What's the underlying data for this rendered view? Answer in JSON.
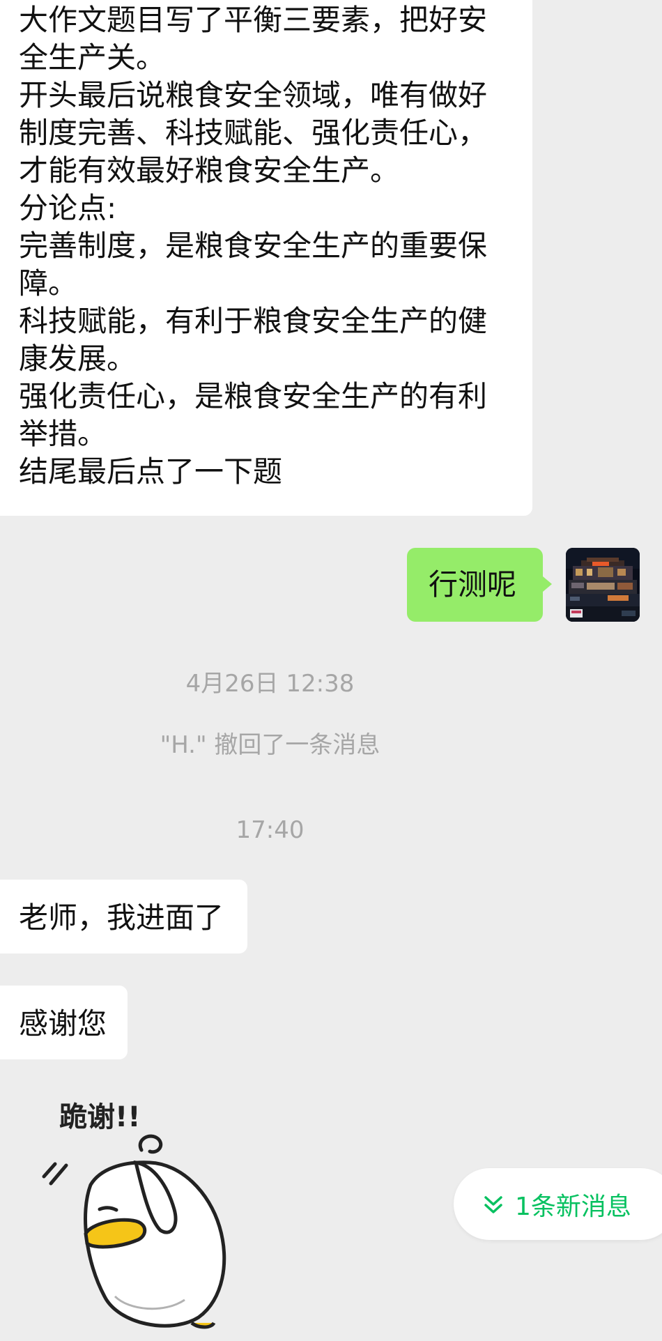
{
  "messages": {
    "long_text_lines": [
      "大作文题目写了平衡三要素，把好安",
      "全生产关。",
      "开头最后说粮食安全领域，唯有做好",
      "制度完善、科技赋能、强化责任心，",
      "才能有效最好粮食安全生产。",
      "分论点:",
      "完善制度，是粮食安全生产的重要保",
      "障。",
      "科技赋能，有利于粮食安全生产的健",
      "康发展。",
      "强化责任心，是粮食安全生产的有利",
      "举措。",
      "结尾最后点了一下题"
    ],
    "sent_text": "行测呢",
    "time_1": "4月26日 12:38",
    "recall_notice": "\"H.\" 撤回了一条消息",
    "time_2": "17:40",
    "reply_1": "老师，我进面了",
    "reply_2": "感谢您",
    "sticker_text": "跪谢!!"
  },
  "new_message_button": {
    "label": "1条新消息",
    "icon": "double-chevron-down-icon",
    "color": "#07c160"
  },
  "colors": {
    "background": "#ededed",
    "received_bubble": "#ffffff",
    "sent_bubble": "#95ec69",
    "system_text": "#a6a6a6"
  }
}
